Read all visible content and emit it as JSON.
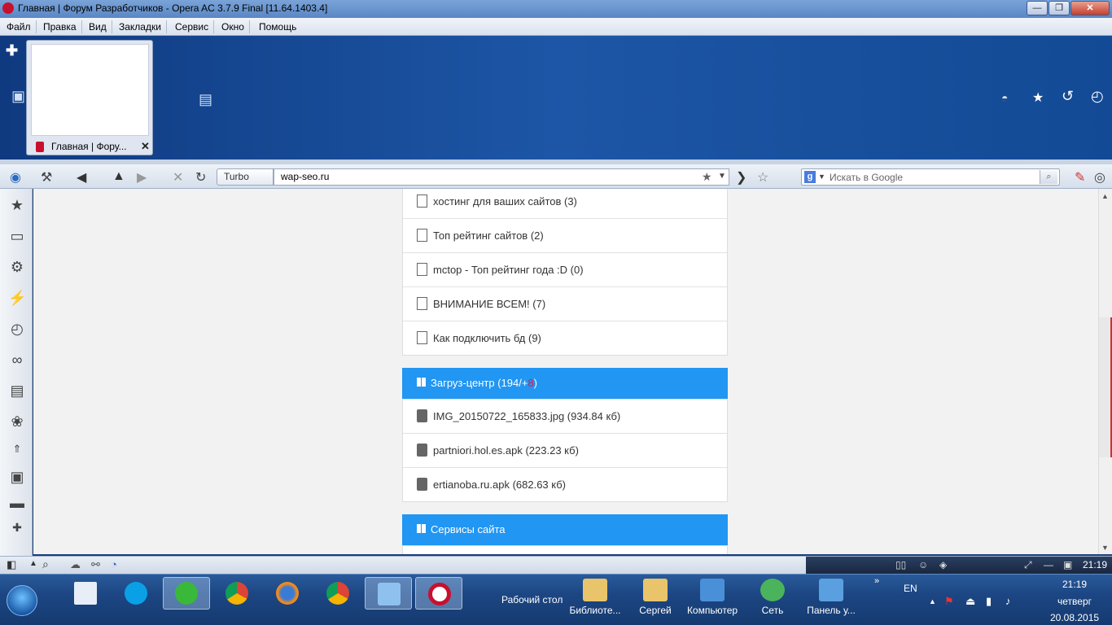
{
  "window": {
    "title": "Главная | Форум Разработчиков - Opera AC 3.7.9 Final [11.64.1403.4]",
    "minimize": "—",
    "maximize": "❐",
    "close": "✕"
  },
  "menu": [
    "Файл",
    "Правка",
    "Вид",
    "Закладки",
    "Сервис",
    "Окно",
    "Помощь"
  ],
  "tab": {
    "label": "Главная | Фору...",
    "close": "✕"
  },
  "toolbar": {
    "turbo_label": "Turbo",
    "url": "wap-seo.ru",
    "search_placeholder": "Искать в Google",
    "search_engine_icon": "g"
  },
  "topics": [
    {
      "label": "хостинг для ваших сайтов (3)"
    },
    {
      "label": "Топ рейтинг сайтов (2)"
    },
    {
      "label": "mctop - Топ рейтинг года :D (0)"
    },
    {
      "label": "ВНИМАНИЕ ВСЕМ! (7)"
    },
    {
      "label": "Как подключить бд (9)"
    }
  ],
  "downloads": {
    "title": "Загруз-центр (194/+",
    "new_count": "8",
    "title_end": ")",
    "items": [
      {
        "label": "IMG_20150722_165833.jpg (934.84 кб)"
      },
      {
        "label": "partniori.hol.es.apk (223.23 кб)"
      },
      {
        "label": "ertianoba.ru.apk (682.63 кб)"
      }
    ]
  },
  "services": {
    "title": "Сервисы сайта"
  },
  "status": {
    "clock": "21:19"
  },
  "taskbar": {
    "desktop_label": "Рабочий стол",
    "quick": [
      {
        "label": "Библиоте...",
        "color": "#e9c46a"
      },
      {
        "label": "Сергей",
        "color": "#e9c46a"
      },
      {
        "label": "Компьютер",
        "color": "#4a90d9"
      },
      {
        "label": "Сеть",
        "color": "#4ab35c"
      },
      {
        "label": "Панель у...",
        "color": "#5aa0e0"
      }
    ],
    "lang": "EN",
    "time": "21:19",
    "day": "четверг",
    "date": "20.08.2015"
  }
}
